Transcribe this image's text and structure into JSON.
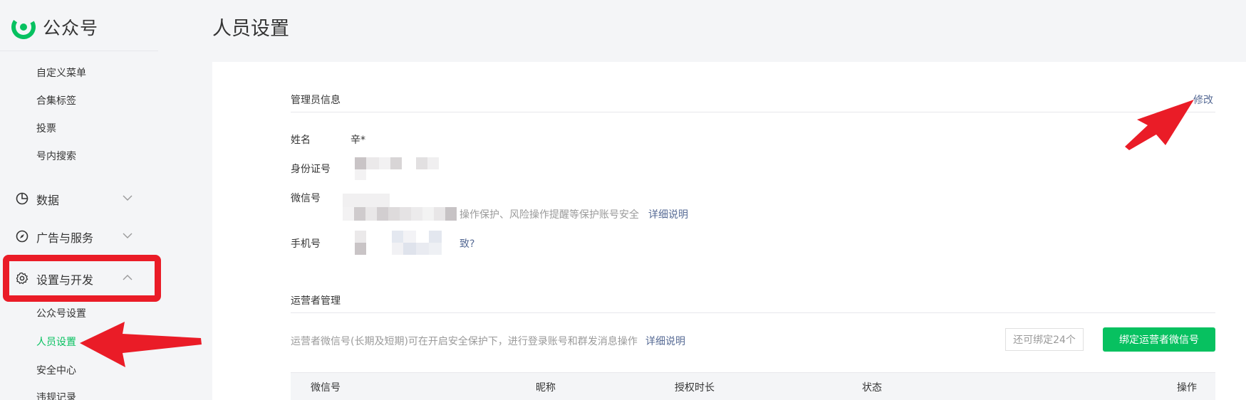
{
  "sidebar": {
    "logo_text": "公众号",
    "sub_items_top": [
      "自定义菜单",
      "合集标签",
      "投票",
      "号内搜索"
    ],
    "groups": [
      {
        "label": "数据",
        "icon": "pie-chart-icon",
        "expanded": false
      },
      {
        "label": "广告与服务",
        "icon": "compass-icon",
        "expanded": false
      },
      {
        "label": "设置与开发",
        "icon": "gear-icon",
        "expanded": true
      }
    ],
    "settings_items": [
      "公众号设置",
      "人员设置",
      "安全中心",
      "违规记录"
    ],
    "active_item": "人员设置"
  },
  "page": {
    "title": "人员设置"
  },
  "admin": {
    "section_title": "管理员信息",
    "edit_label": "修改",
    "fields": {
      "name_label": "姓名",
      "name_value": "辛*",
      "id_label": "身份证号",
      "wechat_label": "微信号",
      "wechat_tip": "操作保护、风险操作提醒等保护账号安全",
      "wechat_tip_link": "详细说明",
      "phone_label": "手机号",
      "phone_tip": "致?"
    }
  },
  "operators": {
    "section_title": "运营者管理",
    "description": "运营者微信号(长期及短期)可在开启安全保护下，进行登录账号和群发消息操作",
    "description_link": "详细说明",
    "remaining": "还可绑定24个",
    "bind_button": "绑定运营者微信号",
    "table_headers": [
      "微信号",
      "昵称",
      "授权时长",
      "状态",
      "操作"
    ]
  },
  "colors": {
    "accent_green": "#07c160",
    "link_blue": "#576b95",
    "annotation_red": "#ea1c27"
  }
}
